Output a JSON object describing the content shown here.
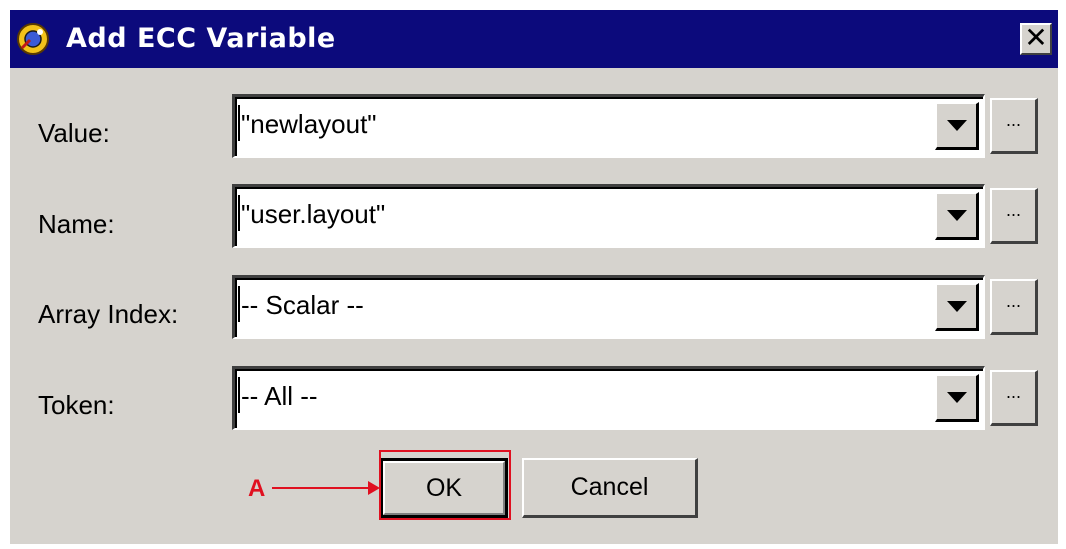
{
  "window": {
    "title": "Add ECC Variable",
    "close_glyph": "✕"
  },
  "fields": [
    {
      "label": "Value:",
      "value": "\"newlayout\""
    },
    {
      "label": "Name:",
      "value": "\"user.layout\""
    },
    {
      "label": "Array Index:",
      "value": "-- Scalar --"
    },
    {
      "label": "Token:",
      "value": "-- All --"
    }
  ],
  "browse_label": "...",
  "buttons": {
    "ok": "OK",
    "cancel": "Cancel"
  },
  "annotation": {
    "label": "A",
    "color": "#e01020"
  },
  "icons": [
    "app-icon",
    "close-icon",
    "dropdown-arrow-icon",
    "browse-ellipsis-icon",
    "annotation-arrow-icon"
  ]
}
